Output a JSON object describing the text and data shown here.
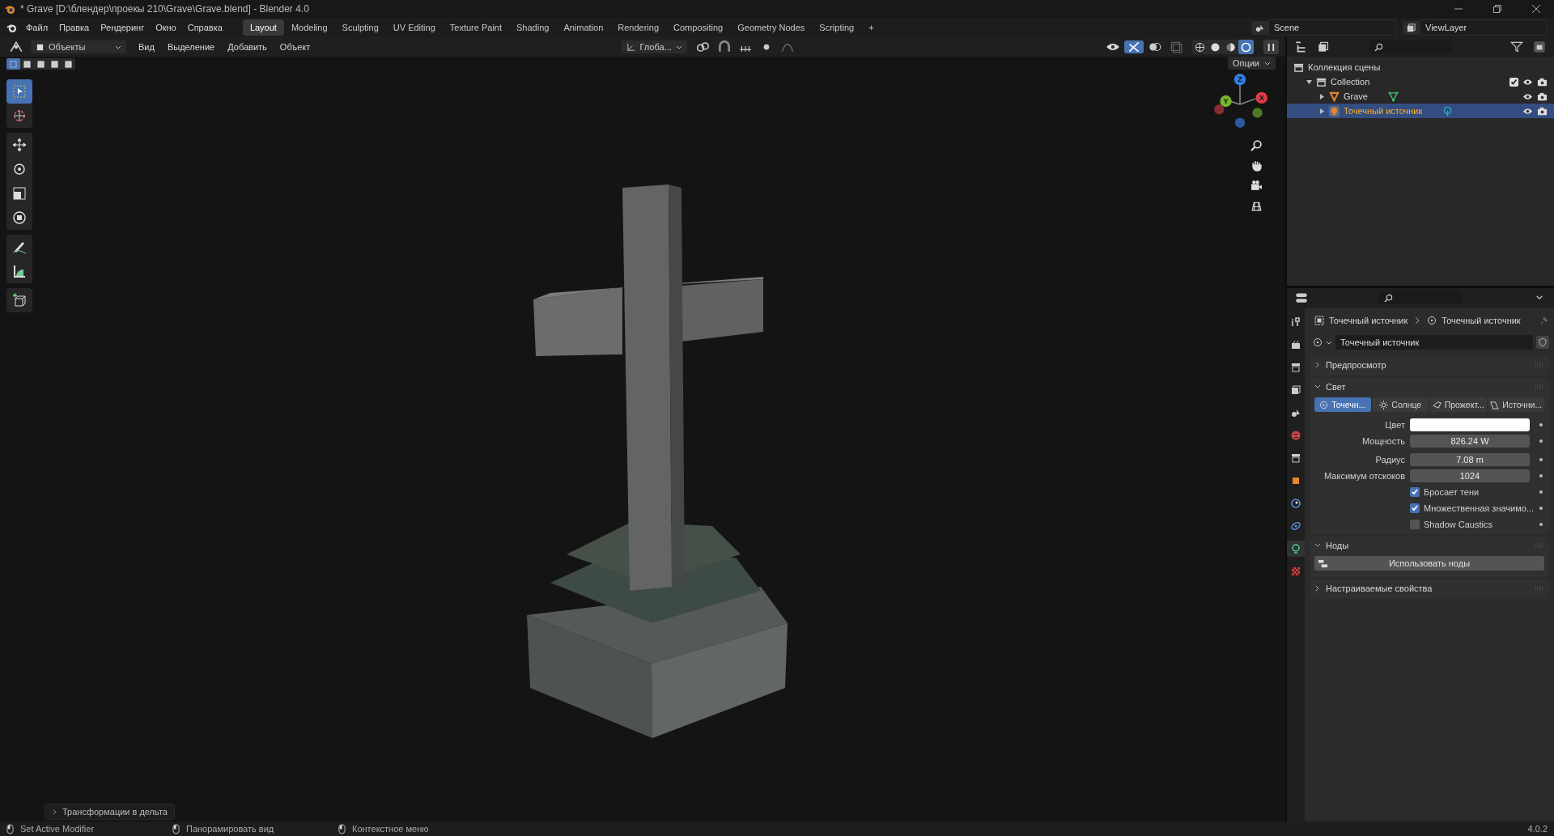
{
  "window": {
    "title": "* Grave [D:\\блендер\\проекы 210\\Grave\\Grave.blend] - Blender 4.0"
  },
  "menu": [
    "Файл",
    "Правка",
    "Рендеринг",
    "Окно",
    "Справка"
  ],
  "workspaces": [
    {
      "label": "Layout",
      "selected": true
    },
    {
      "label": "Modeling",
      "selected": false
    },
    {
      "label": "Sculpting",
      "selected": false
    },
    {
      "label": "UV Editing",
      "selected": false
    },
    {
      "label": "Texture Paint",
      "selected": false
    },
    {
      "label": "Shading",
      "selected": false
    },
    {
      "label": "Animation",
      "selected": false
    },
    {
      "label": "Rendering",
      "selected": false
    },
    {
      "label": "Compositing",
      "selected": false
    },
    {
      "label": "Geometry Nodes",
      "selected": false
    },
    {
      "label": "Scripting",
      "selected": false
    },
    {
      "label": "+",
      "selected": false
    }
  ],
  "scene": "Scene",
  "view_layer": "ViewLayer",
  "viewport_header": {
    "mode": "Объекты",
    "menus": [
      "Вид",
      "Выделение",
      "Добавить",
      "Объект"
    ],
    "orientation": "Глоба...",
    "options": "Опции",
    "shading": [
      {
        "selected": false
      },
      {
        "selected": false
      },
      {
        "selected": false
      },
      {
        "selected": true
      }
    ]
  },
  "select_modes": [
    {
      "selected": true
    },
    {
      "selected": false
    },
    {
      "selected": false
    },
    {
      "selected": false
    },
    {
      "selected": false
    }
  ],
  "tool_groups": [
    [
      {
        "kind": "select",
        "selected": true
      },
      {
        "kind": "cursor",
        "selected": false
      }
    ],
    [
      {
        "kind": "move",
        "selected": false
      },
      {
        "kind": "rotate",
        "selected": false
      },
      {
        "kind": "scale",
        "selected": false
      },
      {
        "kind": "transform",
        "selected": false
      }
    ],
    [
      {
        "kind": "annotate",
        "selected": false
      },
      {
        "kind": "measure",
        "selected": false
      }
    ],
    [
      {
        "kind": "add-cube",
        "selected": false
      }
    ]
  ],
  "gizmo_axes": [
    "X",
    "Y",
    "Z"
  ],
  "last_operator": "Трансформации в дельта",
  "outliner": {
    "items": [
      {
        "label": "Коллекция сцены",
        "kind": "scene-collection",
        "children": [
          {
            "label": "Collection",
            "kind": "collection",
            "expanded": true,
            "selected": false,
            "checked": true,
            "children": [
              {
                "label": "Grave",
                "kind": "mesh",
                "expanded": false,
                "selected": false
              },
              {
                "label": "Точечный источник",
                "kind": "light",
                "expanded": false,
                "selected": true
              }
            ]
          }
        ]
      }
    ]
  },
  "properties": {
    "tabs": [
      {
        "kind": "tool",
        "selected": false
      },
      {
        "kind": "render",
        "selected": false
      },
      {
        "kind": "output",
        "selected": false
      },
      {
        "kind": "view-layer",
        "selected": false
      },
      {
        "kind": "scene",
        "selected": false
      },
      {
        "kind": "world",
        "selected": false
      },
      {
        "kind": "collection",
        "selected": false
      },
      {
        "kind": "object",
        "selected": false
      },
      {
        "kind": "physics",
        "selected": false
      },
      {
        "kind": "constraints",
        "selected": false
      },
      {
        "kind": "light-data",
        "selected": true
      },
      {
        "kind": "texture",
        "selected": false
      }
    ],
    "breadcrumb": [
      "Точечный источник",
      "Точечный источник"
    ],
    "datablock": "Точечный источник",
    "panels": [
      {
        "title": "Предпросмотр",
        "expanded": false
      },
      {
        "kind": "light",
        "title": "Свет",
        "expanded": true,
        "light_types": [
          {
            "label": "Точечн...",
            "selected": true
          },
          {
            "label": "Солнце",
            "selected": false
          },
          {
            "label": "Прожект...",
            "selected": false
          },
          {
            "label": "Источни...",
            "selected": false
          }
        ],
        "rows": [
          {
            "kind": "color",
            "label": "Цвет",
            "color": "#ffffff"
          },
          {
            "kind": "value",
            "label": "Мощность",
            "value": "826.24 W"
          },
          {
            "kind": "value",
            "label": "Радиус",
            "value": "7.08 m"
          },
          {
            "kind": "value",
            "label": "Максимум отскоков",
            "value": "1024"
          },
          {
            "kind": "checkbox",
            "label": "Бросает тени",
            "checked": true
          },
          {
            "kind": "checkbox",
            "label": "Множественная значимо...",
            "checked": true
          },
          {
            "kind": "checkbox",
            "label": "Shadow Caustics",
            "checked": false
          }
        ]
      },
      {
        "kind": "nodes",
        "title": "Ноды",
        "expanded": true,
        "button": "Использовать ноды"
      },
      {
        "title": "Настраиваемые свойства",
        "expanded": false
      }
    ]
  },
  "status_bar": {
    "hints": [
      "Set Active Modifier",
      "Панорамировать вид",
      "Контекстное меню"
    ],
    "version": "4.0.2"
  }
}
